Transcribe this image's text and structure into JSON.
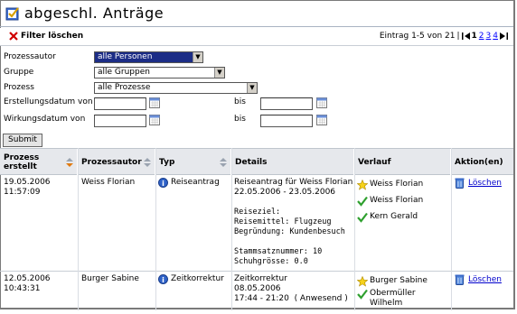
{
  "header": {
    "title": "abgeschl. Anträge"
  },
  "toolbar": {
    "filter_clear_label": "Filter löschen",
    "pager_text": "Eintrag 1-5 von 21",
    "pages": [
      "1",
      "2",
      "3",
      "4"
    ]
  },
  "filters": {
    "prozessautor_label": "Prozessautor",
    "prozessautor_value": "alle Personen",
    "gruppe_label": "Gruppe",
    "gruppe_value": "alle Gruppen",
    "prozess_label": "Prozess",
    "prozess_value": "alle Prozesse",
    "erstellungsdatum_label": "Erstellungsdatum von",
    "wirkungsdatum_label": "Wirkungsdatum von",
    "bis_label": "bis",
    "submit_label": "Submit"
  },
  "table": {
    "headers": {
      "erstellt": "Prozess erstellt",
      "autor": "Prozessautor",
      "typ": "Typ",
      "details": "Details",
      "verlauf": "Verlauf",
      "aktion": "Aktion(en)"
    },
    "rows": [
      {
        "date": "19.05.2006",
        "time": "11:57:09",
        "author": "Weiss Florian",
        "type": "Reiseantrag",
        "details_title": "Reiseantrag für Weiss Florian",
        "details_range": "22.05.2006 - 23.05.2006",
        "details_ziel": "Reiseziel:",
        "details_mittel": "Reisemittel: Flugzeug",
        "details_begr": "Begründung: Kundenbesuch",
        "details_stamm": "Stammsatznummer: 10",
        "details_schuh": "Schuhgrösse: 0.0",
        "verlauf": [
          "Weiss Florian",
          "Weiss Florian",
          "Kern Gerald"
        ],
        "action": "Löschen"
      },
      {
        "date": "12.05.2006",
        "time": "10:43:31",
        "author": "Burger Sabine",
        "type": "Zeitkorrektur",
        "details_title": "Zeitkorrektur",
        "details_date": "08.05.2006",
        "details_time": "17:44 - 21:20  ( Anwesend )",
        "verlauf": [
          "Burger Sabine",
          "Obermüller Wilhelm"
        ],
        "action": "Löschen"
      }
    ]
  },
  "colors": {
    "accent": "#1c2d86",
    "header_bg": "#e6e8ec",
    "link": "#0000cc",
    "sort_arrow": "#e07a10"
  },
  "icons": [
    "checklist-icon",
    "close-icon",
    "calendar-icon",
    "info-icon",
    "star-icon",
    "check-icon",
    "trash-icon"
  ]
}
